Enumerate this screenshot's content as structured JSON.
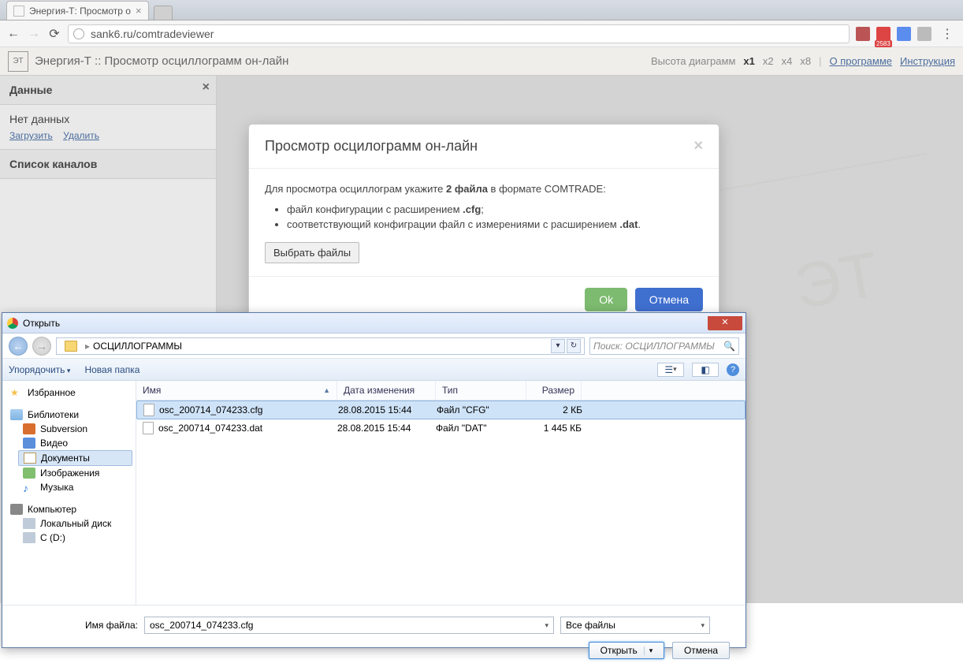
{
  "browser": {
    "tab_title": "Энергия-Т: Просмотр о",
    "url": "sank6.ru/comtradeviewer",
    "gmail_badge": "2583"
  },
  "header": {
    "title": "Энергия-Т :: Просмотр осциллограмм он-лайн",
    "scale_label": "Высота диаграмм",
    "scales": [
      "x1",
      "x2",
      "x4",
      "x8"
    ],
    "about": "О программе",
    "instructions": "Инструкция"
  },
  "sidebar": {
    "data_title": "Данные",
    "no_data": "Нет данных",
    "load": "Загрузить",
    "delete": "Удалить",
    "channels_title": "Список каналов"
  },
  "modal": {
    "title": "Просмотр осцилограмм он-лайн",
    "intro_pre": "Для просмотра осциллограм укажите ",
    "intro_bold": "2 файла",
    "intro_post": " в формате COMTRADE:",
    "li1_pre": "файл конфигурации с расширением ",
    "li1_bold": ".cfg",
    "li1_post": ";",
    "li2_pre": "соответствующий конфиграции файл с измерениями с расширением ",
    "li2_bold": ".dat",
    "li2_post": ".",
    "select_files": "Выбрать файлы",
    "ok": "Ok",
    "cancel": "Отмена"
  },
  "dialog": {
    "title": "Открыть",
    "breadcrumb_folder": "ОСЦИЛЛОГРАММЫ",
    "search_placeholder": "Поиск: ОСЦИЛЛОГРАММЫ",
    "organize": "Упорядочить",
    "new_folder": "Новая папка",
    "tree": {
      "favorites": "Избранное",
      "libraries": "Библиотеки",
      "subversion": "Subversion",
      "video": "Видео",
      "documents": "Документы",
      "images": "Изображения",
      "music": "Музыка",
      "computer": "Компьютер",
      "local_disk": "Локальный диск",
      "cdrive": "C (D:)"
    },
    "columns": {
      "name": "Имя",
      "date": "Дата изменения",
      "type": "Тип",
      "size": "Размер"
    },
    "files": [
      {
        "name": "osc_200714_074233.cfg",
        "date": "28.08.2015 15:44",
        "type": "Файл \"CFG\"",
        "size": "2 КБ",
        "selected": true
      },
      {
        "name": "osc_200714_074233.dat",
        "date": "28.08.2015 15:44",
        "type": "Файл \"DAT\"",
        "size": "1 445 КБ",
        "selected": false
      }
    ],
    "filename_label": "Имя файла:",
    "filename_value": "osc_200714_074233.cfg",
    "filetype": "Все файлы",
    "open": "Открыть",
    "cancel": "Отмена"
  }
}
